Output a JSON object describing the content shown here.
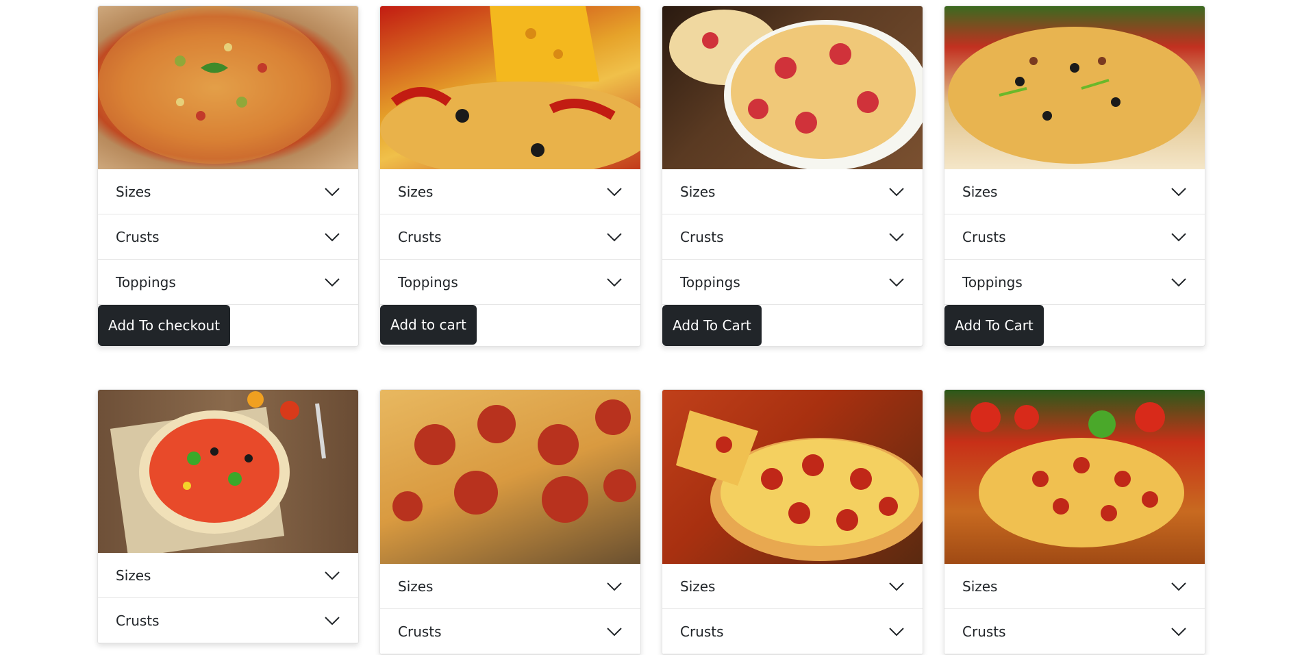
{
  "colors": {
    "button_bg": "#212529",
    "button_text": "#ffffff",
    "card_border": "#e3e3e3",
    "text": "#212529"
  },
  "cards": [
    {
      "image": "supreme-pizza-photo",
      "sizes": "Sizes",
      "crusts": "Crusts",
      "toppings": "Toppings",
      "button": "Add To checkout"
    },
    {
      "image": "pepper-cheese-pizza-photo",
      "sizes": "Sizes",
      "crusts": "Crusts",
      "toppings": "Toppings",
      "button": "Add to cart"
    },
    {
      "image": "pepperoni-pizza-photo",
      "sizes": "Sizes",
      "crusts": "Crusts",
      "toppings": "Toppings",
      "button": "Add To Cart"
    },
    {
      "image": "veggie-pizza-photo",
      "sizes": "Sizes",
      "crusts": "Crusts",
      "toppings": "Toppings",
      "button": "Add To Cart"
    },
    {
      "image": "basil-pizza-photo",
      "sizes": "Sizes",
      "crusts": "Crusts"
    },
    {
      "image": "pepperoni-closeup-photo",
      "sizes": "Sizes",
      "crusts": "Crusts"
    },
    {
      "image": "cheese-pull-pizza-photo",
      "sizes": "Sizes",
      "crusts": "Crusts"
    },
    {
      "image": "pepperoni-board-photo",
      "sizes": "Sizes",
      "crusts": "Crusts"
    }
  ]
}
